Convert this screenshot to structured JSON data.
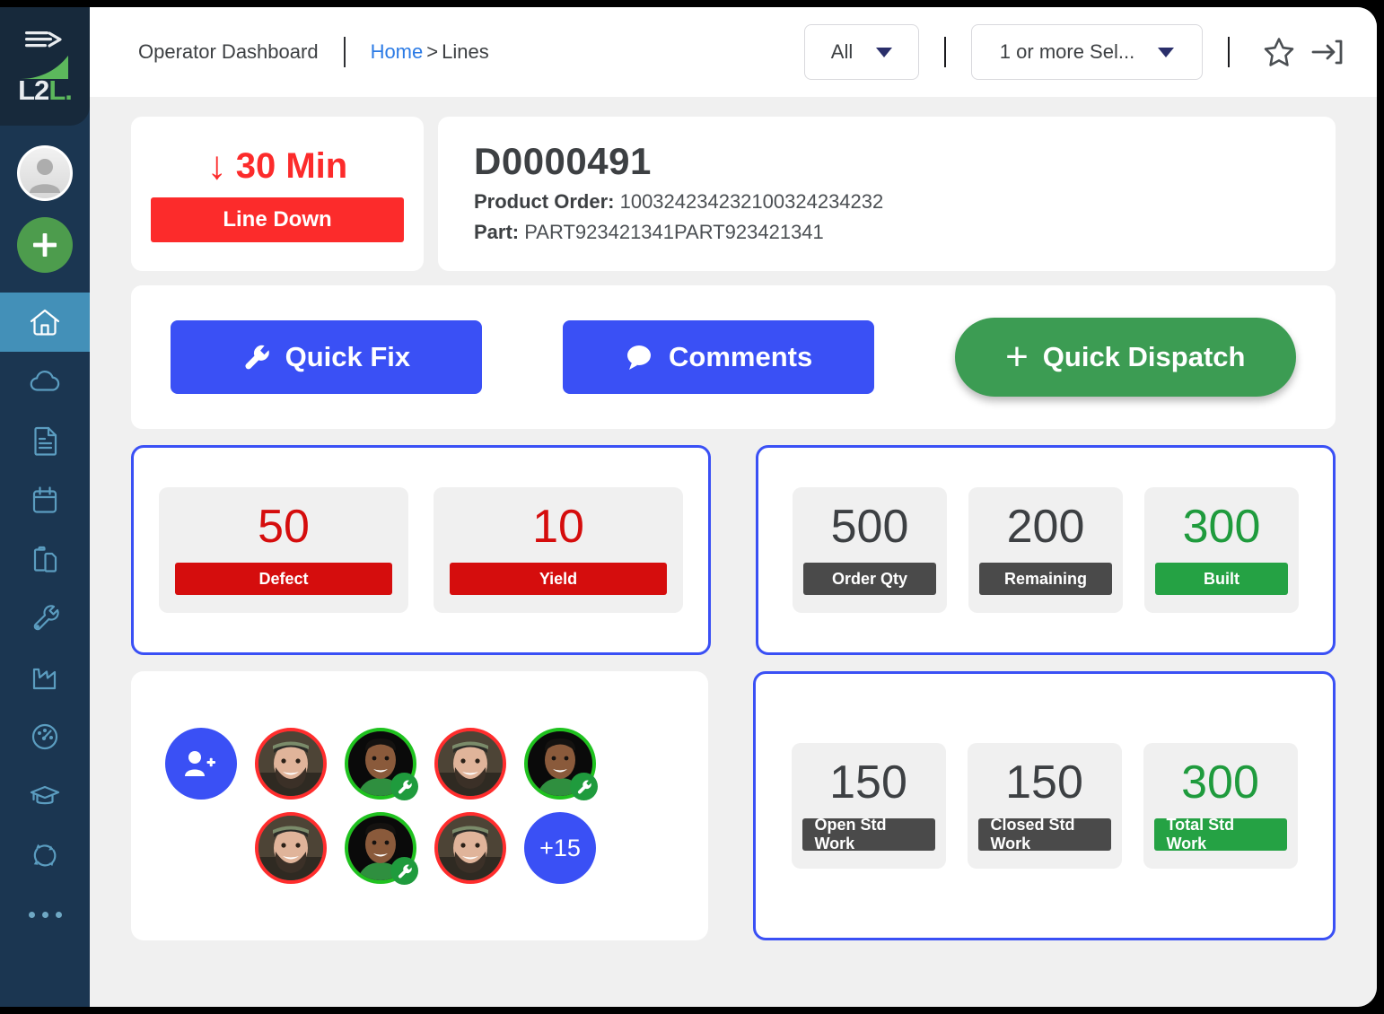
{
  "app": {
    "logo_text_primary": "L2",
    "logo_text_accent": "L",
    "accent_blue": "#3a50f5",
    "accent_green": "#3c9c53",
    "danger_red": "#fc2b2b",
    "sidebar_bg": "#1b3651",
    "sidebar_active_bg": "#4390b8"
  },
  "header": {
    "title": "Operator Dashboard",
    "breadcrumb": {
      "link": "Home",
      "separator": ">",
      "current": "Lines"
    },
    "filter_all": {
      "value": "All",
      "options": [
        "All"
      ]
    },
    "filter_select": {
      "value": "1 or more Sel...",
      "options": [
        "1 or more Sel..."
      ]
    },
    "favorite_icon": "star-icon",
    "signin_icon": "sign-in-icon"
  },
  "sidebar": {
    "profile_icon": "user-avatar-icon",
    "add_icon": "plus-icon",
    "items": [
      {
        "name": "home",
        "icon": "home-icon",
        "active": true
      },
      {
        "name": "cloud",
        "icon": "cloud-icon",
        "active": false
      },
      {
        "name": "documents",
        "icon": "document-icon",
        "active": false
      },
      {
        "name": "calendar",
        "icon": "calendar-icon",
        "active": false
      },
      {
        "name": "clipboard",
        "icon": "clipboard-icon",
        "active": false
      },
      {
        "name": "maintenance",
        "icon": "wrench-icon",
        "active": false
      },
      {
        "name": "production",
        "icon": "factory-icon",
        "active": false
      },
      {
        "name": "performance",
        "icon": "gauge-icon",
        "active": false
      },
      {
        "name": "training",
        "icon": "graduation-cap-icon",
        "active": false
      },
      {
        "name": "cycles",
        "icon": "refresh-cycle-icon",
        "active": false
      },
      {
        "name": "more",
        "icon": "ellipsis-icon",
        "active": false
      }
    ]
  },
  "status": {
    "down_arrow": "↓",
    "duration": "30 Min",
    "pill_label": "Line Down"
  },
  "order": {
    "id": "D0000491",
    "product_order_label": "Product Order:",
    "product_order_value": "100324234232100324234232",
    "part_label": "Part:",
    "part_value": "PART923421341PART923421341"
  },
  "actions": {
    "quick_fix": {
      "label": "Quick Fix",
      "icon": "wrench-icon"
    },
    "comments": {
      "label": "Comments",
      "icon": "comment-bubble-icon"
    },
    "quick_dispatch": {
      "label": "Quick Dispatch",
      "icon": "plus-icon"
    }
  },
  "quality_panel": {
    "tiles": [
      {
        "value": "50",
        "label": "Defect",
        "value_color": "red",
        "label_color": "red"
      },
      {
        "value": "10",
        "label": "Yield",
        "value_color": "red",
        "label_color": "red"
      }
    ]
  },
  "order_panel": {
    "tiles": [
      {
        "value": "500",
        "label": "Order Qty",
        "value_color": "dark",
        "label_color": "dark"
      },
      {
        "value": "200",
        "label": "Remaining",
        "value_color": "dark",
        "label_color": "dark"
      },
      {
        "value": "300",
        "label": "Built",
        "value_color": "green",
        "label_color": "green"
      }
    ]
  },
  "stdwork_panel": {
    "tiles": [
      {
        "value": "150",
        "label": "Open Std Work",
        "value_color": "dark",
        "label_color": "dark"
      },
      {
        "value": "150",
        "label": "Closed Std Work",
        "value_color": "dark",
        "label_color": "dark"
      },
      {
        "value": "300",
        "label": "Total Std Work",
        "value_color": "green",
        "label_color": "green"
      }
    ]
  },
  "people_panel": {
    "add_remove_icon": "user-add-remove-icon",
    "overflow_label": "+15",
    "row1": [
      {
        "type": "avatar",
        "face": "bearded-man",
        "ring": "red",
        "badge": false
      },
      {
        "type": "avatar",
        "face": "green-polo",
        "ring": "green",
        "badge": true
      },
      {
        "type": "avatar",
        "face": "bearded-man",
        "ring": "red",
        "badge": false
      },
      {
        "type": "avatar",
        "face": "green-polo",
        "ring": "green",
        "badge": true
      }
    ],
    "row2": [
      {
        "type": "avatar",
        "face": "bearded-man",
        "ring": "red",
        "badge": false
      },
      {
        "type": "avatar",
        "face": "green-polo",
        "ring": "green",
        "badge": true
      },
      {
        "type": "avatar",
        "face": "bearded-man",
        "ring": "red",
        "badge": false
      }
    ]
  }
}
